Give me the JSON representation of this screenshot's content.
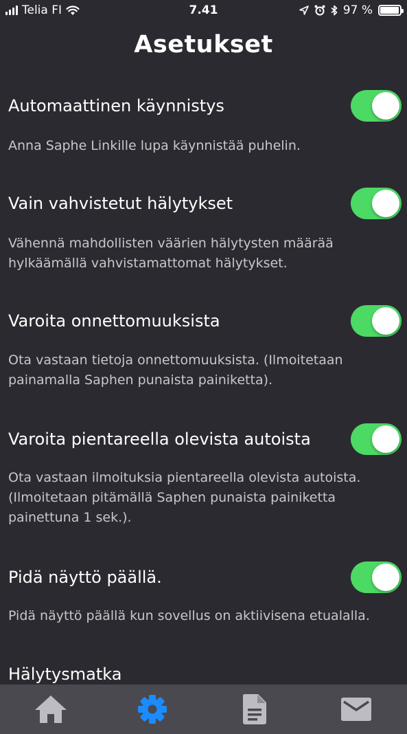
{
  "status_bar": {
    "carrier": "Telia FI",
    "time": "7.41",
    "battery": "97 %",
    "battery_level": 0.97
  },
  "page": {
    "title": "Asetukset"
  },
  "settings": [
    {
      "title": "Automaattinen käynnistys",
      "description": "Anna Saphe Linkille lupa käynnistää puhelin.",
      "enabled": true
    },
    {
      "title": "Vain vahvistetut hälytykset",
      "description": "Vähennä mahdollisten väärien hälytysten määrää hylkäämällä vahvistamattomat hälytykset.",
      "enabled": true
    },
    {
      "title": "Varoita onnettomuuksista",
      "description": "Ota vastaan tietoja onnettomuuksista. (Ilmoitetaan painamalla Saphen punaista painiketta).",
      "enabled": true
    },
    {
      "title": "Varoita pientareella olevista autoista",
      "description": "Ota vastaan ilmoituksia pientareella olevista autoista. (Ilmoitetaan pitämällä Saphen punaista painiketta painettuna 1 sek.).",
      "enabled": true
    },
    {
      "title": "Pidä näyttö päällä.",
      "description": "Pidä näyttö päällä kun sovellus on aktiivisena etualalla.",
      "enabled": true
    },
    {
      "title": "Hälytysmatka"
    }
  ],
  "tab_bar": {
    "tabs": [
      {
        "icon": "home-icon",
        "active": false
      },
      {
        "icon": "gear-icon",
        "active": true
      },
      {
        "icon": "document-icon",
        "active": false
      },
      {
        "icon": "mail-icon",
        "active": false
      }
    ],
    "active_color": "#1a8cff",
    "inactive_color": "#bdbcc2"
  },
  "colors": {
    "background": "#2b2a30",
    "toggle_on": "#4cd964",
    "tab_bar": "#4a4950"
  }
}
